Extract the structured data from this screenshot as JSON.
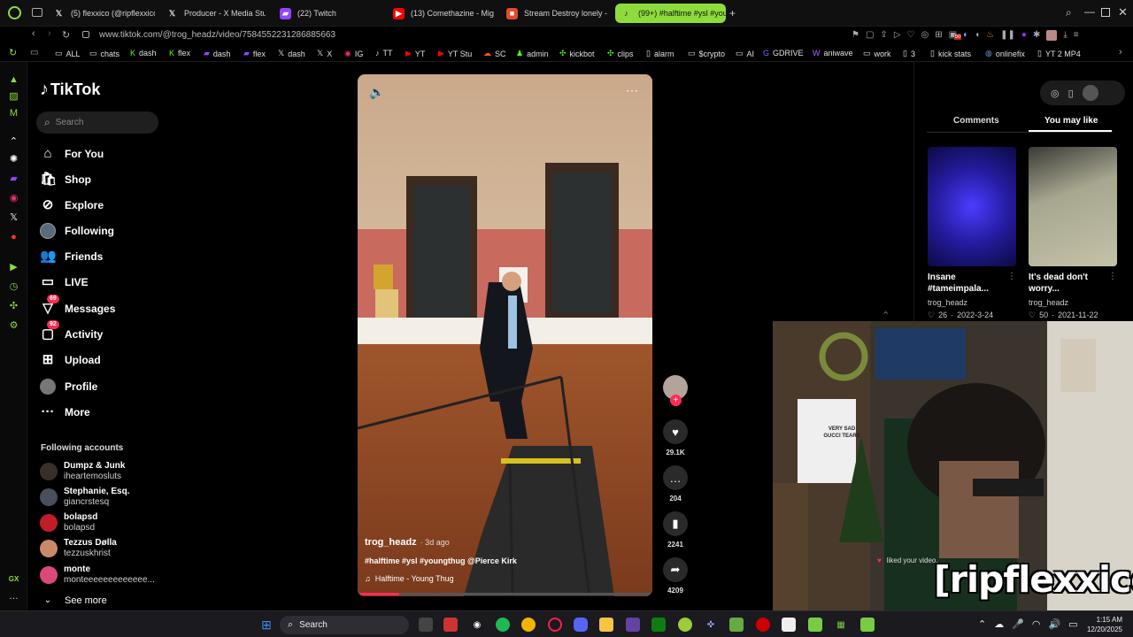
{
  "browser": {
    "tabs": [
      {
        "label": "(5) flexxico (@ripflexxico) / X",
        "icon": "x-icon"
      },
      {
        "label": "Producer - X Media Studio",
        "icon": "x-icon"
      },
      {
        "label": "(22) Twitch",
        "icon": "twitch-icon"
      },
      {
        "label": "(13) Comethazine - Might",
        "icon": "youtube-icon"
      },
      {
        "label": "Stream Destroy lonely - Ki",
        "icon": "kick-icon"
      },
      {
        "label": "(99+) #halftime #ysl #you",
        "icon": "tiktok-icon",
        "active": true
      }
    ],
    "url": "www.tiktok.com/@trog_headz/video/7584552231286885663",
    "bookmarks": [
      "ALL",
      "chats",
      "dash",
      "flex",
      "dash",
      "flex",
      "dash",
      "X",
      "IG",
      "TT",
      "YT",
      "YT Stu",
      "SC",
      "admin",
      "kickbot",
      "clips",
      "alarm",
      "$crypto",
      "AI",
      "GDRIVE",
      "aniwave",
      "work",
      "3",
      "kick stats",
      "onlinefix",
      "YT 2 MP4"
    ],
    "ext_badge": "50"
  },
  "tiktok": {
    "logo": "TikTok",
    "search_placeholder": "Search",
    "nav": [
      {
        "label": "For You",
        "icon": "home-icon"
      },
      {
        "label": "Shop",
        "icon": "shop-icon"
      },
      {
        "label": "Explore",
        "icon": "compass-icon"
      },
      {
        "label": "Following",
        "icon": "following-avatar-icon"
      },
      {
        "label": "Friends",
        "icon": "friends-icon"
      },
      {
        "label": "LIVE",
        "icon": "live-icon"
      },
      {
        "label": "Messages",
        "icon": "messages-icon",
        "badge": "69"
      },
      {
        "label": "Activity",
        "icon": "activity-icon",
        "badge": "92"
      },
      {
        "label": "Upload",
        "icon": "upload-icon"
      },
      {
        "label": "Profile",
        "icon": "profile-avatar-icon"
      },
      {
        "label": "More",
        "icon": "more-icon"
      }
    ],
    "following_title": "Following accounts",
    "following": [
      {
        "name": "Dumpz & Junk",
        "handle": "iheartemosluts",
        "color": "#3a2e2a"
      },
      {
        "name": "Stephanie, Esq.",
        "handle": "giancrstesq",
        "color": "#4b4f5c"
      },
      {
        "name": "bolapsd",
        "handle": "bolapsd",
        "color": "#c21c2a"
      },
      {
        "name": "Tezzus Dølla",
        "handle": "tezzuskhrist",
        "color": "#c98a6b"
      },
      {
        "name": "monte",
        "handle": "monteeeeeeeeeeeee...",
        "color": "#d94a7a"
      }
    ],
    "see_more": "See more",
    "video": {
      "author": "trog_headz",
      "age": "· 3d ago",
      "caption": "#halftime #ysl #youngthug @Pierce Kirk",
      "sound": "Halftime - Young Thug"
    },
    "actions": {
      "likes": "29.1K",
      "comments": "204",
      "saves": "2241",
      "shares": "4209"
    },
    "panel_tabs": [
      "Comments",
      "You may like"
    ],
    "cards": [
      {
        "title": "Insane #tameimpala...",
        "user": "trog_headz",
        "likes": "26",
        "date": "2022-3-24"
      },
      {
        "title": "It's dead don't worry...",
        "user": "trog_headz",
        "likes": "50",
        "date": "2021-11-22"
      }
    ]
  },
  "webcam": {
    "overlay_name": "[ripflexxico]",
    "notice": "liked your video.",
    "shirt_text": "VERY SAD GUCCI TEARS"
  },
  "taskbar": {
    "search": "Search",
    "time": "1:15 AM",
    "date": "12/20/2025"
  }
}
